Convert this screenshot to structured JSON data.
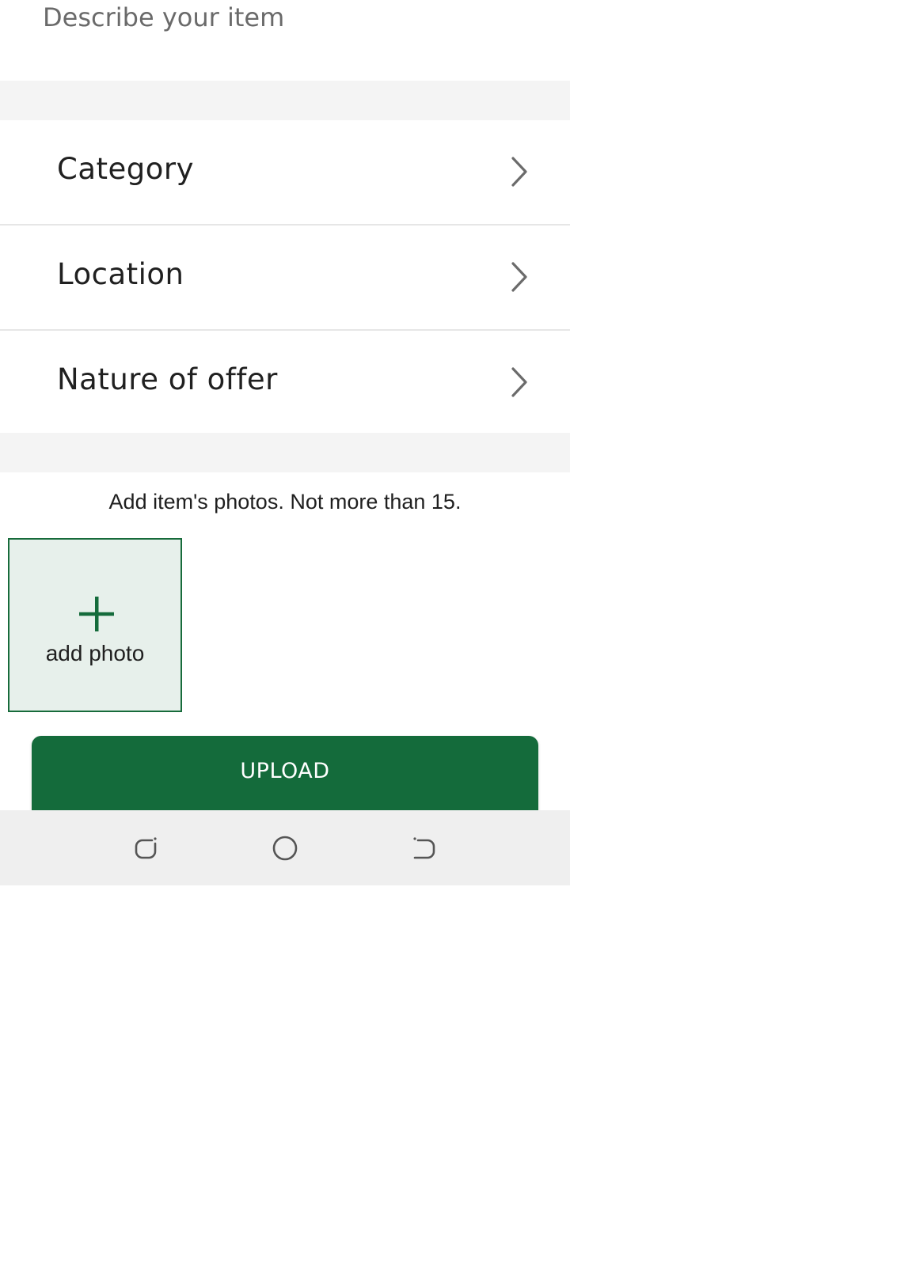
{
  "describe": {
    "value": "",
    "placeholder": "Describe your item"
  },
  "options": {
    "category_label": "Category",
    "location_label": "Location",
    "nature_label": "Nature of offer"
  },
  "photos": {
    "note": "Add item's photos. Not more than 15.",
    "add_label": "add photo",
    "max_count": 15
  },
  "upload": {
    "label": "UPLOAD"
  },
  "colors": {
    "accent": "#146b3b",
    "section_gap": "#f4f4f4",
    "nav_bar": "#efefef",
    "add_photo_bg": "#e7f0eb"
  },
  "icons": {
    "chevron": "chevron-right-icon",
    "plus": "plus-icon",
    "nav": [
      "recents-icon",
      "home-icon",
      "back-icon"
    ]
  }
}
